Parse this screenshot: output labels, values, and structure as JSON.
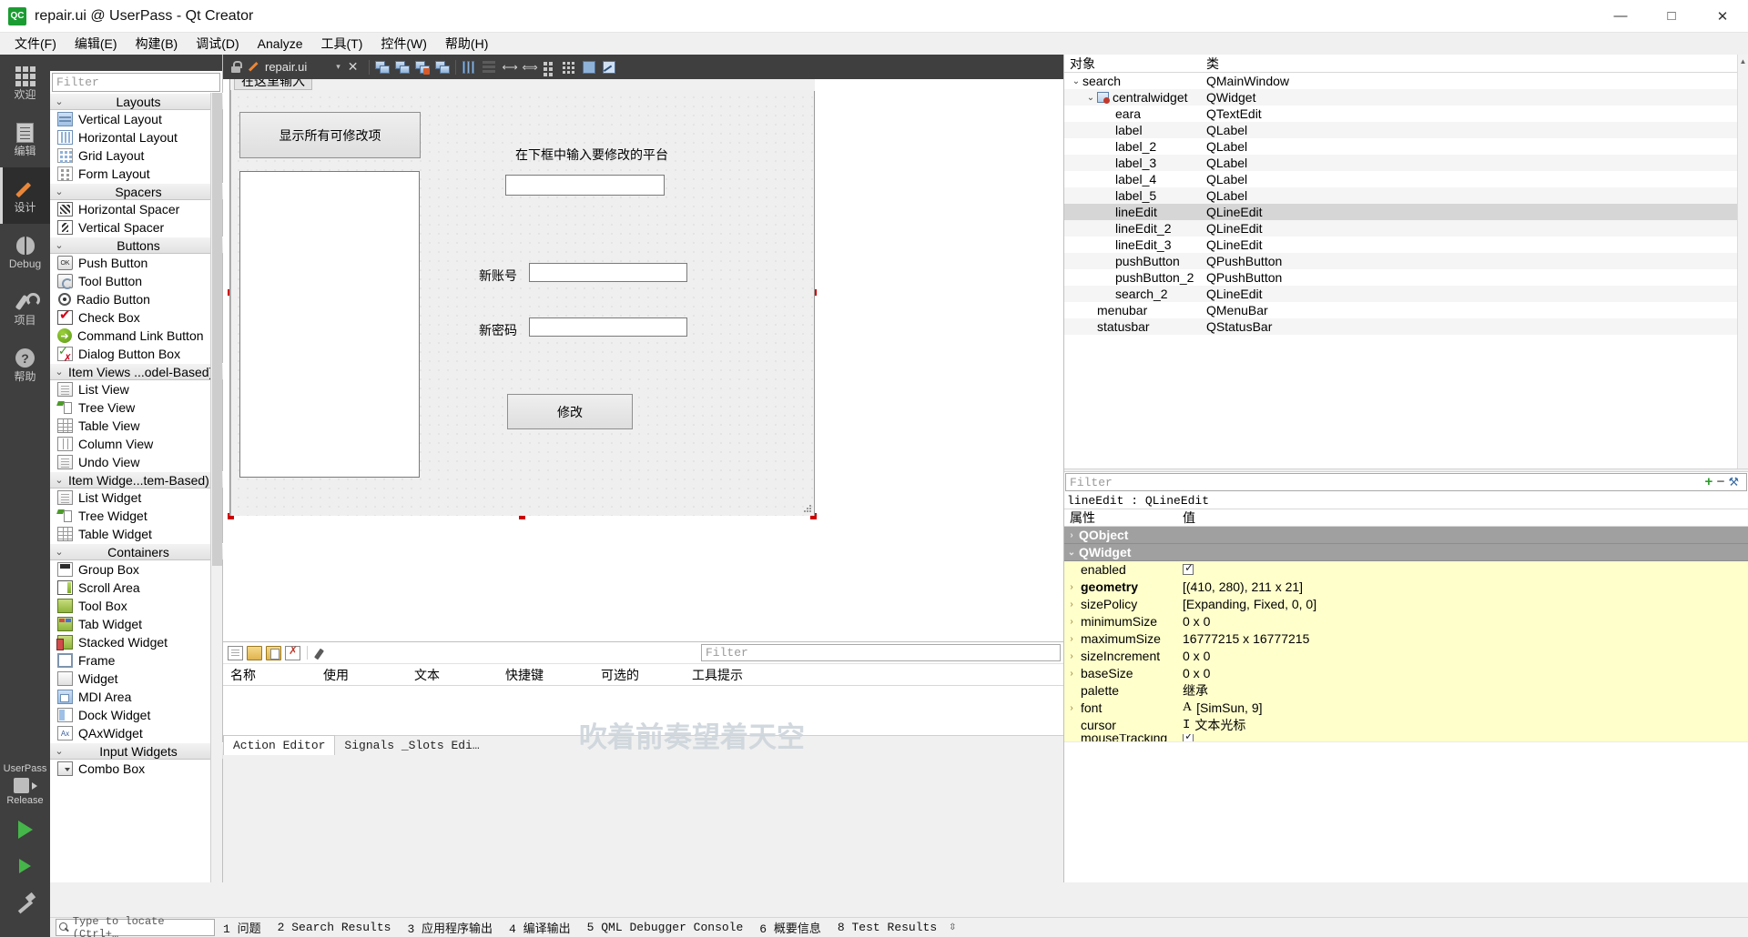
{
  "window": {
    "title": "repair.ui @ UserPass - Qt Creator",
    "logo_text": "QC",
    "minimize": "—",
    "maximize": "□",
    "close": "✕"
  },
  "menubar": [
    {
      "label": "文件(F)"
    },
    {
      "label": "编辑(E)"
    },
    {
      "label": "构建(B)"
    },
    {
      "label": "调试(D)"
    },
    {
      "label": "Analyze"
    },
    {
      "label": "工具(T)"
    },
    {
      "label": "控件(W)"
    },
    {
      "label": "帮助(H)"
    }
  ],
  "mode_rail": {
    "items": [
      {
        "label": "欢迎",
        "icon": "grid-icon",
        "active": false
      },
      {
        "label": "编辑",
        "icon": "document-icon",
        "active": false
      },
      {
        "label": "设计",
        "icon": "pencil-icon",
        "active": true
      },
      {
        "label": "Debug",
        "icon": "bug-icon",
        "active": false
      },
      {
        "label": "项目",
        "icon": "wrench-icon",
        "active": false
      },
      {
        "label": "帮助",
        "icon": "help-icon",
        "active": false
      }
    ],
    "kit_name": "UserPass",
    "kit_config": "Release"
  },
  "widget_box": {
    "filter_placeholder": "Filter",
    "groups": [
      {
        "title": "Layouts",
        "left_aligned": false,
        "items": [
          {
            "label": "Vertical Layout",
            "icon": "vertical-layout-icon",
            "cls": "ic-vlayout"
          },
          {
            "label": "Horizontal Layout",
            "icon": "horizontal-layout-icon",
            "cls": "ic-hlayout"
          },
          {
            "label": "Grid Layout",
            "icon": "grid-layout-icon",
            "cls": "ic-grid"
          },
          {
            "label": "Form Layout",
            "icon": "form-layout-icon",
            "cls": "ic-form"
          }
        ]
      },
      {
        "title": "Spacers",
        "left_aligned": false,
        "items": [
          {
            "label": "Horizontal Spacer",
            "icon": "horizontal-spacer-icon",
            "cls": "ic-hspacer"
          },
          {
            "label": "Vertical Spacer",
            "icon": "vertical-spacer-icon",
            "cls": "ic-vspacer"
          }
        ]
      },
      {
        "title": "Buttons",
        "left_aligned": false,
        "items": [
          {
            "label": "Push Button",
            "icon": "push-button-icon",
            "cls": "ic-push",
            "glyph": "OK"
          },
          {
            "label": "Tool Button",
            "icon": "tool-button-icon",
            "cls": "ic-tool"
          },
          {
            "label": "Radio Button",
            "icon": "radio-button-icon",
            "cls": "ic-radio"
          },
          {
            "label": "Check Box",
            "icon": "check-box-icon",
            "cls": "ic-check"
          },
          {
            "label": "Command Link Button",
            "icon": "command-link-icon",
            "cls": "ic-cmdlink",
            "glyph": "➔"
          },
          {
            "label": "Dialog Button Box",
            "icon": "dialog-button-box-icon",
            "cls": "ic-dlgbtn"
          }
        ]
      },
      {
        "title": "Item Views ...odel-Based)",
        "left_aligned": true,
        "items": [
          {
            "label": "List View",
            "icon": "list-view-icon",
            "cls": "ic-listview"
          },
          {
            "label": "Tree View",
            "icon": "tree-view-icon",
            "cls": "ic-treeview"
          },
          {
            "label": "Table View",
            "icon": "table-view-icon",
            "cls": "ic-tableview"
          },
          {
            "label": "Column View",
            "icon": "column-view-icon",
            "cls": "ic-colview"
          },
          {
            "label": "Undo View",
            "icon": "undo-view-icon",
            "cls": "ic-listview"
          }
        ]
      },
      {
        "title": "Item Widge...tem-Based)",
        "left_aligned": true,
        "items": [
          {
            "label": "List Widget",
            "icon": "list-widget-icon",
            "cls": "ic-listview"
          },
          {
            "label": "Tree Widget",
            "icon": "tree-widget-icon",
            "cls": "ic-treeview"
          },
          {
            "label": "Table Widget",
            "icon": "table-widget-icon",
            "cls": "ic-tableview"
          }
        ]
      },
      {
        "title": "Containers",
        "left_aligned": false,
        "items": [
          {
            "label": "Group Box",
            "icon": "group-box-icon",
            "cls": "ic-groupbox"
          },
          {
            "label": "Scroll Area",
            "icon": "scroll-area-icon",
            "cls": "ic-scroll"
          },
          {
            "label": "Tool Box",
            "icon": "tool-box-icon",
            "cls": "ic-toolbox"
          },
          {
            "label": "Tab Widget",
            "icon": "tab-widget-icon",
            "cls": "ic-tabwidget"
          },
          {
            "label": "Stacked Widget",
            "icon": "stacked-widget-icon",
            "cls": "ic-stacked"
          },
          {
            "label": "Frame",
            "icon": "frame-icon",
            "cls": "ic-frame"
          },
          {
            "label": "Widget",
            "icon": "widget-icon",
            "cls": "ic-widget"
          },
          {
            "label": "MDI Area",
            "icon": "mdi-area-icon",
            "cls": "ic-mdi"
          },
          {
            "label": "Dock Widget",
            "icon": "dock-widget-icon",
            "cls": "ic-dock"
          },
          {
            "label": "QAxWidget",
            "icon": "qax-widget-icon",
            "cls": "ic-qax",
            "glyph": "Ax"
          }
        ]
      },
      {
        "title": "Input Widgets",
        "left_aligned": false,
        "items": [
          {
            "label": "Combo Box",
            "icon": "combo-box-icon",
            "cls": "ic-combo"
          }
        ]
      }
    ]
  },
  "designer": {
    "tab_label": "repair.ui",
    "form": {
      "menubar_placeholder": "在这里输入",
      "widgets": [
        {
          "type": "pushbutton",
          "name": "pushButton",
          "text": "显示所有可修改项"
        },
        {
          "type": "textedit",
          "name": "eara",
          "text": ""
        },
        {
          "type": "label",
          "name": "label",
          "text": "在下框中输入要修改的平台"
        },
        {
          "type": "lineedit",
          "name": "search_2",
          "text": ""
        },
        {
          "type": "label",
          "name": "label_2",
          "text": "新账号"
        },
        {
          "type": "lineedit",
          "name": "lineEdit",
          "text": ""
        },
        {
          "type": "label",
          "name": "label_3",
          "text": "新密码"
        },
        {
          "type": "lineedit",
          "name": "lineEdit_2",
          "text": ""
        },
        {
          "type": "pushbutton",
          "name": "pushButton_2",
          "text": "修改"
        }
      ]
    }
  },
  "object_inspector": {
    "headers": {
      "name": "对象",
      "class": "类"
    },
    "rows": [
      {
        "name": "search",
        "class": "QMainWindow",
        "indent": 0,
        "twisty": "⌄",
        "selected": false,
        "alt": false,
        "icon": ""
      },
      {
        "name": "centralwidget",
        "class": "QWidget",
        "indent": 1,
        "twisty": "⌄",
        "selected": false,
        "alt": true,
        "icon": "central-widget-icon"
      },
      {
        "name": "eara",
        "class": "QTextEdit",
        "indent": 2,
        "twisty": "",
        "selected": false,
        "alt": false,
        "icon": ""
      },
      {
        "name": "label",
        "class": "QLabel",
        "indent": 2,
        "twisty": "",
        "selected": false,
        "alt": true,
        "icon": ""
      },
      {
        "name": "label_2",
        "class": "QLabel",
        "indent": 2,
        "twisty": "",
        "selected": false,
        "alt": false,
        "icon": ""
      },
      {
        "name": "label_3",
        "class": "QLabel",
        "indent": 2,
        "twisty": "",
        "selected": false,
        "alt": true,
        "icon": ""
      },
      {
        "name": "label_4",
        "class": "QLabel",
        "indent": 2,
        "twisty": "",
        "selected": false,
        "alt": false,
        "icon": ""
      },
      {
        "name": "label_5",
        "class": "QLabel",
        "indent": 2,
        "twisty": "",
        "selected": false,
        "alt": true,
        "icon": ""
      },
      {
        "name": "lineEdit",
        "class": "QLineEdit",
        "indent": 2,
        "twisty": "",
        "selected": true,
        "alt": false,
        "icon": ""
      },
      {
        "name": "lineEdit_2",
        "class": "QLineEdit",
        "indent": 2,
        "twisty": "",
        "selected": false,
        "alt": true,
        "icon": ""
      },
      {
        "name": "lineEdit_3",
        "class": "QLineEdit",
        "indent": 2,
        "twisty": "",
        "selected": false,
        "alt": false,
        "icon": ""
      },
      {
        "name": "pushButton",
        "class": "QPushButton",
        "indent": 2,
        "twisty": "",
        "selected": false,
        "alt": true,
        "icon": ""
      },
      {
        "name": "pushButton_2",
        "class": "QPushButton",
        "indent": 2,
        "twisty": "",
        "selected": false,
        "alt": false,
        "icon": ""
      },
      {
        "name": "search_2",
        "class": "QLineEdit",
        "indent": 2,
        "twisty": "",
        "selected": false,
        "alt": true,
        "icon": ""
      },
      {
        "name": "menubar",
        "class": "QMenuBar",
        "indent": 1,
        "twisty": "",
        "selected": false,
        "alt": false,
        "icon": ""
      },
      {
        "name": "statusbar",
        "class": "QStatusBar",
        "indent": 1,
        "twisty": "",
        "selected": false,
        "alt": true,
        "icon": ""
      }
    ]
  },
  "property_editor": {
    "filter_placeholder": "Filter",
    "object_line": "lineEdit : QLineEdit",
    "headers": {
      "property": "属性",
      "value": "值"
    },
    "add_button": "+",
    "remove_button": "−",
    "config_button": "⚒",
    "rows": [
      {
        "kind": "group",
        "name": "QObject",
        "twisty": "›",
        "value": ""
      },
      {
        "kind": "group",
        "name": "QWidget",
        "twisty": "⌄",
        "value": ""
      },
      {
        "kind": "prop",
        "name": "enabled",
        "twisty": "",
        "value": "",
        "value_type": "checkbox",
        "bold": false
      },
      {
        "kind": "prop",
        "name": "geometry",
        "twisty": "›",
        "value": "[(410, 280), 211 x 21]",
        "value_type": "text",
        "bold": true
      },
      {
        "kind": "prop",
        "name": "sizePolicy",
        "twisty": "›",
        "value": "[Expanding, Fixed, 0, 0]",
        "value_type": "text",
        "bold": false
      },
      {
        "kind": "prop",
        "name": "minimumSize",
        "twisty": "›",
        "value": "0 x 0",
        "value_type": "text",
        "bold": false
      },
      {
        "kind": "prop",
        "name": "maximumSize",
        "twisty": "›",
        "value": "16777215 x 16777215",
        "value_type": "text",
        "bold": false
      },
      {
        "kind": "prop",
        "name": "sizeIncrement",
        "twisty": "›",
        "value": "0 x 0",
        "value_type": "text",
        "bold": false
      },
      {
        "kind": "prop",
        "name": "baseSize",
        "twisty": "›",
        "value": "0 x 0",
        "value_type": "text",
        "bold": false
      },
      {
        "kind": "prop",
        "name": "palette",
        "twisty": "",
        "value": "继承",
        "value_type": "text",
        "bold": false
      },
      {
        "kind": "prop",
        "name": "font",
        "twisty": "›",
        "value": "[SimSun, 9]",
        "value_type": "font",
        "bold": false
      },
      {
        "kind": "prop",
        "name": "cursor",
        "twisty": "",
        "value": "文本光标",
        "value_type": "cursor",
        "bold": false
      },
      {
        "kind": "prop",
        "name": "mouseTracking",
        "twisty": "",
        "value": "",
        "value_type": "checkbox",
        "bold": false
      }
    ]
  },
  "action_editor": {
    "filter_placeholder": "Filter",
    "headers": [
      "名称",
      "使用",
      "文本",
      "快捷键",
      "可选的",
      "工具提示"
    ],
    "tabs": [
      {
        "label": "Action Editor",
        "active": true
      },
      {
        "label": "Signals _Slots Edi…",
        "active": false
      }
    ]
  },
  "watermark": "吹着前奏望着天空",
  "statusbar": {
    "locator_placeholder": "Type to locate (Ctrl+…",
    "items": [
      "1 问题",
      "2 Search Results",
      "3 应用程序输出",
      "4 编译输出",
      "5 QML Debugger Console",
      "6 概要信息",
      "8 Test Results"
    ],
    "updown": "⇳"
  }
}
